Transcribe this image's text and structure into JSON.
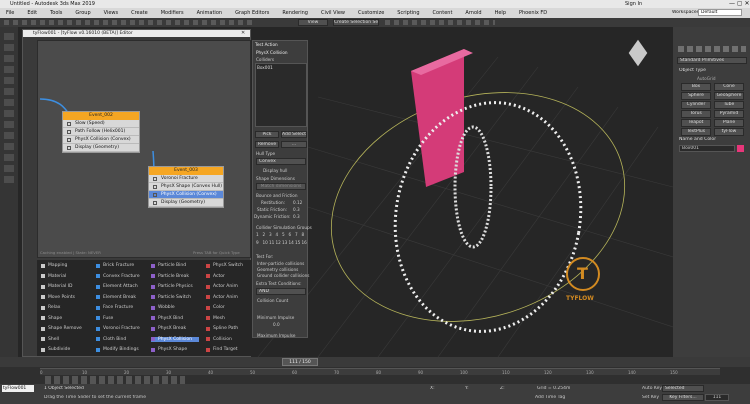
{
  "window": {
    "title": "Untitled - Autodesk 3ds Max 2019",
    "sign_in": "Sign In",
    "workspaces_label": "Workspaces:",
    "workspace": "Default"
  },
  "menu": [
    "File",
    "Edit",
    "Tools",
    "Group",
    "Views",
    "Create",
    "Modifiers",
    "Animation",
    "Graph Editors",
    "Rendering",
    "Civil View",
    "Customize",
    "Scripting",
    "Content",
    "Arnold",
    "Help",
    "Phoenix FD"
  ],
  "toolbar": {
    "view_dropdown": "View",
    "selection_set": "Create Selection Se"
  },
  "editor": {
    "title": "tyFlow001 - [tyFlow v0.16010 (BETA)] Editor",
    "status_left": "Caching enabled | State: NEVER",
    "status_right": "Press TAB for Quick Type",
    "event1": {
      "name": "Event_002",
      "ops": [
        "Slow (Speed)",
        "Path Follow (Helix001)",
        "PhysX Collision (Convex)",
        "Display (Geometry)"
      ]
    },
    "event2": {
      "name": "Event_003",
      "ops": [
        "Voronoi Fracture",
        "PhysX Shape (Convex Hull)",
        "PhysX Collision (Convex)",
        "Display (Geometry)"
      ],
      "selected": 2
    },
    "palette": [
      [
        "Mapping",
        "Material",
        "Material ID",
        "Move Points",
        "Relax",
        "Shape",
        "Shape Remove",
        "Shell",
        "Subdivide"
      ],
      [
        "Brick Fracture",
        "Convex Fracture",
        "Element Attach",
        "Element Break",
        "Face Fracture",
        "Fuse",
        "Voronoi Fracture",
        "Cloth Bind",
        "Modify Bindings"
      ],
      [
        "Particle Bind",
        "Particle Break",
        "Particle Physics",
        "Particle Switch",
        "Wobble",
        "PhysX Bind",
        "PhysX Break",
        "PhysX Collision",
        "PhysX Shape"
      ],
      [
        "PhysX Switch",
        "Actor",
        "Actor Anim",
        "Actor Anim",
        "Color",
        "Mesh",
        "Spline Path",
        "Collision",
        "Find Target"
      ]
    ]
  },
  "test_panel": {
    "title": "Test Action",
    "section": "PhysX Collision",
    "colliders_label": "Colliders",
    "collider_item": "Box001",
    "pick": "Pick",
    "add_selected": "Add Selected",
    "remove": "Remove",
    "more": "...",
    "hull_type_label": "Hull Type",
    "hull_type": "Convex",
    "display_hull": "Display hull",
    "shape_dims_label": "Shape Dimensions",
    "shape_dims_btn": "Match dimensions",
    "bounce_label": "Bounce and Friction",
    "restitution": "Restitution:",
    "restitution_val": "0.12",
    "static_friction": "Static Friction:",
    "static_val": "0.3",
    "dynamic_friction": "Dynamic Friction:",
    "dynamic_val": "0.3",
    "groups_label": "Collider Simulation Groups",
    "group_vals": [
      "1",
      "2",
      "3",
      "4",
      "5",
      "6",
      "7",
      "8",
      "9",
      "10",
      "11",
      "12",
      "13",
      "14",
      "15",
      "16"
    ],
    "test_for": "Test For:",
    "inter": "Inter-particle collisions",
    "geom": "Geometry collisions",
    "ground": "Ground collider collisions",
    "extra_label": "Extra Test Conditions:",
    "extra_val": "AND",
    "count_label": "Collision Count",
    "min_impulse": "Minimum Impulse",
    "min_val": "0.0",
    "max_impulse": "Maximum Impulse"
  },
  "command_panel": {
    "dropdown": "Standard Primitives",
    "rollout": "Object Type",
    "autogrid": "AutoGrid",
    "objects": [
      "Box",
      "Cone",
      "Sphere",
      "GeoSphere",
      "Cylinder",
      "Tube",
      "Torus",
      "Pyramid",
      "Teapot",
      "Plane",
      "TextPlus",
      "tyFlow"
    ],
    "name_color": "Name and Color",
    "name_value": "Box001",
    "swatch_color": "#e8367a"
  },
  "viewport": {
    "logo_text": "TYFLOW",
    "box_color": "#d43b78"
  },
  "timeline": {
    "frame_label": "111 / 150",
    "ticks": [
      "0",
      "10",
      "20",
      "30",
      "40",
      "50",
      "60",
      "70",
      "80",
      "90",
      "100",
      "110",
      "120",
      "130",
      "140",
      "150"
    ]
  },
  "bottom": {
    "script_field": "tyFlow001",
    "status": "1 Object Selected",
    "hint": "Drag the Time Slider to set the current frame",
    "x_label": "X:",
    "y_label": "Y:",
    "z_label": "Z:",
    "grid": "Grid = 0.254m",
    "add_time_tag": "Add Time Tag",
    "auto_key": "Auto Key",
    "selected": "Selected",
    "set_key": "Set Key",
    "key_filters": "Key Filters...",
    "frame_value": "111"
  }
}
